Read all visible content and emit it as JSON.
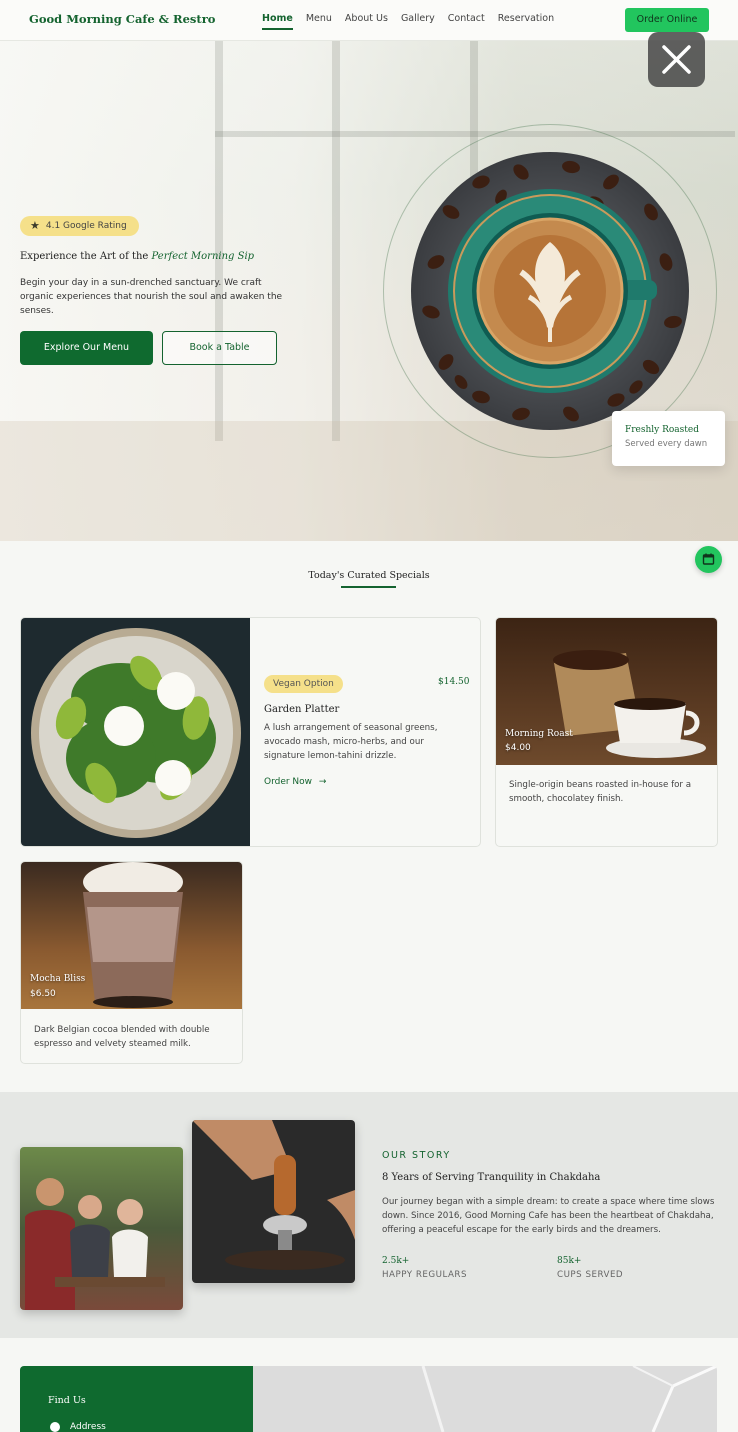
{
  "nav": {
    "brand": "Good Morning Cafe & Restro",
    "links": [
      "Home",
      "Menu",
      "About Us",
      "Gallery",
      "Contact",
      "Reservation"
    ],
    "active": "Home",
    "cta": "Order Online"
  },
  "hero": {
    "rating": "4.1 Google Rating",
    "title_prefix": "Experience the Art of the",
    "title_emphasis": "Perfect Morning Sip",
    "description": "Begin your day in a sun-drenched sanctuary. We craft organic experiences that nourish the soul and awaken the senses.",
    "primary_button": "Explore Our Menu",
    "secondary_button": "Book a Table",
    "badge_title": "Freshly Roasted",
    "badge_subtitle": "Served every dawn"
  },
  "specials": {
    "title": "Today's Curated Specials",
    "items": [
      {
        "badge": "Vegan Option",
        "price": "$14.50",
        "name": "Garden Platter",
        "description": "A lush arrangement of seasonal greens, avocado mash, micro-herbs, and our signature lemon-tahini drizzle.",
        "action": "Order Now"
      },
      {
        "name": "Morning Roast",
        "price": "$4.00",
        "description": "Single-origin beans roasted in-house for a smooth, chocolatey finish."
      },
      {
        "name": "Mocha Bliss",
        "price": "$6.50",
        "description": "Dark Belgian cocoa blended with double espresso and velvety steamed milk."
      }
    ]
  },
  "story": {
    "tag": "OUR STORY",
    "title": "8 Years of Serving Tranquility in Chakdaha",
    "description": "Our journey began with a simple dream: to create a space where time slows down. Since 2016, Good Morning Cafe has been the heartbeat of Chakdaha, offering a peaceful escape for the early birds and the dreamers.",
    "stats": [
      {
        "value": "2.5k+",
        "label": "HAPPY REGULARS"
      },
      {
        "value": "85k+",
        "label": "CUPS SERVED"
      }
    ]
  },
  "find": {
    "title": "Find Us",
    "address_label": "Address"
  },
  "colors": {
    "brand_green": "#14632f",
    "cta_green": "#22c55e",
    "badge_yellow": "#f5e08a"
  }
}
